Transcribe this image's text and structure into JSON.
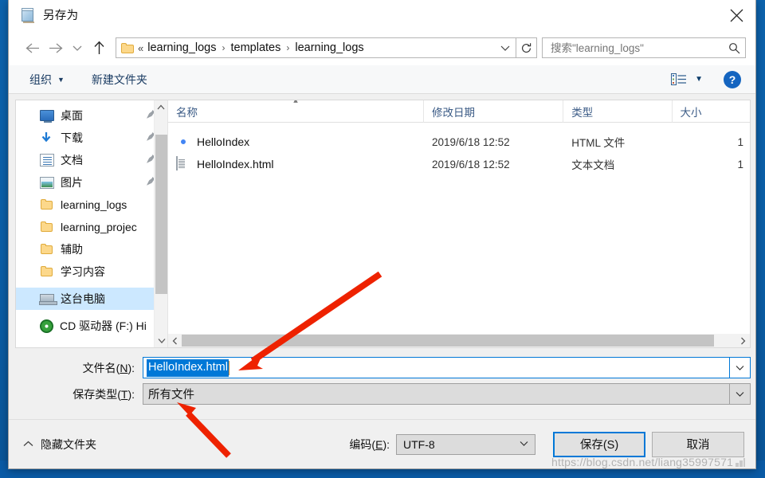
{
  "window": {
    "title": "另存为",
    "icon": "notepad-icon",
    "close_label": "✕"
  },
  "nav": {
    "back_icon": "arrow-left-icon",
    "forward_icon": "arrow-right-icon",
    "recent_icon": "chevron-down-icon",
    "up_icon": "arrow-up-icon",
    "breadcrumb_prefix": "«",
    "breadcrumbs": [
      "learning_logs",
      "templates",
      "learning_logs"
    ],
    "separator": "›",
    "dropdown_icon": "chevron-down-icon",
    "refresh_icon": "refresh-icon"
  },
  "search": {
    "value": "搜索\"learning_logs\"",
    "placeholder": "搜索\"learning_logs\"",
    "icon": "search-icon"
  },
  "commandbar": {
    "organize_label": "组织",
    "organize_caret": "▼",
    "new_folder_label": "新建文件夹",
    "view_icon": "list-view-icon",
    "view_caret": "▼",
    "help_label": "?"
  },
  "sidebar": {
    "items": [
      {
        "label": "桌面",
        "icon": "desktop-icon",
        "pinned": true,
        "selected": false
      },
      {
        "label": "下载",
        "icon": "download-icon",
        "pinned": true,
        "selected": false
      },
      {
        "label": "文档",
        "icon": "documents-icon",
        "pinned": true,
        "selected": false
      },
      {
        "label": "图片",
        "icon": "pictures-icon",
        "pinned": true,
        "selected": false
      },
      {
        "label": "learning_logs",
        "icon": "folder-icon",
        "pinned": false,
        "selected": false
      },
      {
        "label": "learning_projec",
        "icon": "folder-icon",
        "pinned": false,
        "selected": false
      },
      {
        "label": "辅助",
        "icon": "folder-icon",
        "pinned": false,
        "selected": false
      },
      {
        "label": "学习内容",
        "icon": "folder-icon",
        "pinned": false,
        "selected": false
      },
      {
        "label": "这台电脑",
        "icon": "this-pc-icon",
        "pinned": false,
        "selected": true
      },
      {
        "label": "CD 驱动器 (F:) Hi",
        "icon": "cd-drive-icon",
        "pinned": false,
        "selected": false
      }
    ],
    "pin_glyph": "📌",
    "scroll_up_glyph": "⌃",
    "scroll_down_glyph": "⌄"
  },
  "filelist": {
    "columns": [
      "名称",
      "修改日期",
      "类型",
      "大小"
    ],
    "sorted_column": "名称",
    "rows": [
      {
        "name": "HelloIndex",
        "icon": "chrome-file-icon",
        "date": "2019/6/18 12:52",
        "type": "HTML 文件",
        "size": "1"
      },
      {
        "name": "HelloIndex.html",
        "icon": "text-file-icon",
        "date": "2019/6/18 12:52",
        "type": "文本文档",
        "size": "1"
      }
    ],
    "hscroll_left_glyph": "‹",
    "hscroll_right_glyph": "›"
  },
  "form": {
    "filename_label_pre": "文件名(",
    "filename_label_key": "N",
    "filename_label_post": "):",
    "filename_value": "HelloIndex.html",
    "filename_caret_icon": "chevron-down-icon",
    "filetype_label_pre": "保存类型(",
    "filetype_label_key": "T",
    "filetype_label_post": "):",
    "filetype_value": "所有文件",
    "filetype_caret_icon": "chevron-down-icon"
  },
  "footer": {
    "hide_folders_label": "隐藏文件夹",
    "hide_folders_chevron": "⌃",
    "encoding_label_pre": "编码(",
    "encoding_label_key": "E",
    "encoding_label_post": "):",
    "encoding_value": "UTF-8",
    "encoding_caret_icon": "chevron-down-icon",
    "save_label": "保存(S)",
    "cancel_label": "取消"
  },
  "watermark": {
    "text": "https://blog.csdn.net/liang35997571"
  },
  "colors": {
    "accent": "#0078d7",
    "selection": "#cce8ff",
    "annotation": "#ee2200",
    "desktop": "#0a5ba6"
  }
}
